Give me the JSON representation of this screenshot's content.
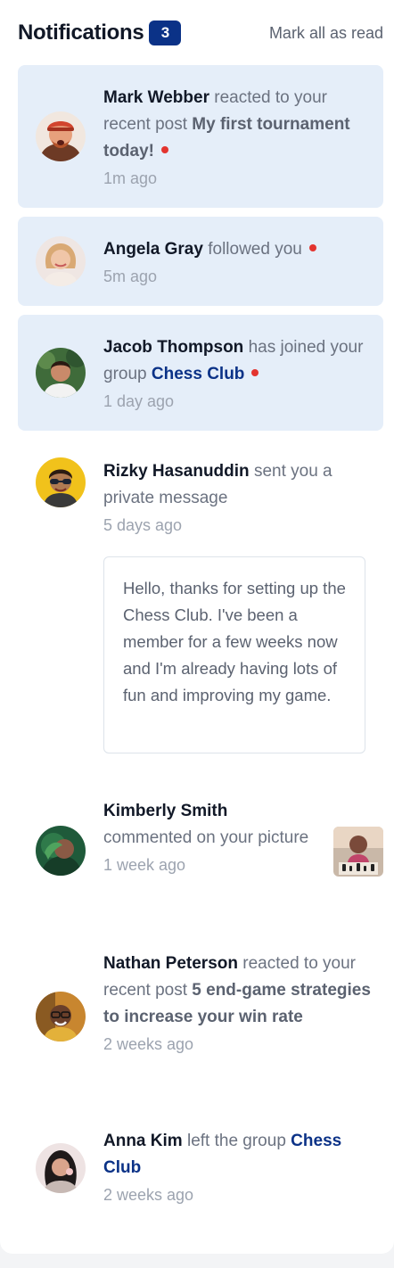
{
  "header": {
    "title": "Notifications",
    "unread_count": "3",
    "mark_all_label": "Mark all as read"
  },
  "notifications": [
    {
      "name": "Mark Webber",
      "action": "reacted to your recent post",
      "target": "My first tournament today!",
      "time": "1m ago",
      "unread": true
    },
    {
      "name": "Angela Gray",
      "action": "followed you",
      "time": "5m ago",
      "unread": true
    },
    {
      "name": "Jacob Thompson",
      "action": "has joined your group",
      "target": "Chess Club",
      "time": "1 day ago",
      "unread": true
    },
    {
      "name": "Rizky Hasanuddin",
      "action": "sent you a private message",
      "time": "5 days ago",
      "message": "Hello, thanks for setting up the Chess Club. I've been a member for a few weeks now and I'm already having lots of fun and improving my game.",
      "unread": false
    },
    {
      "name": "Kimberly Smith",
      "action": "commented on your picture",
      "time": "1 week ago",
      "unread": false
    },
    {
      "name": "Nathan Peterson",
      "action": "reacted to your recent post",
      "target": "5 end-game strategies to increase your win rate",
      "time": "2 weeks ago",
      "unread": false
    },
    {
      "name": "Anna Kim",
      "action": "left the group",
      "target": "Chess Club",
      "time": "2 weeks ago",
      "unread": false
    }
  ],
  "colors": {
    "unread_background": "#e5eef9",
    "badge": "#0b3287",
    "link": "#0b3287",
    "unread_dot": "#e3342f",
    "page_background": "#f3f4f6"
  }
}
